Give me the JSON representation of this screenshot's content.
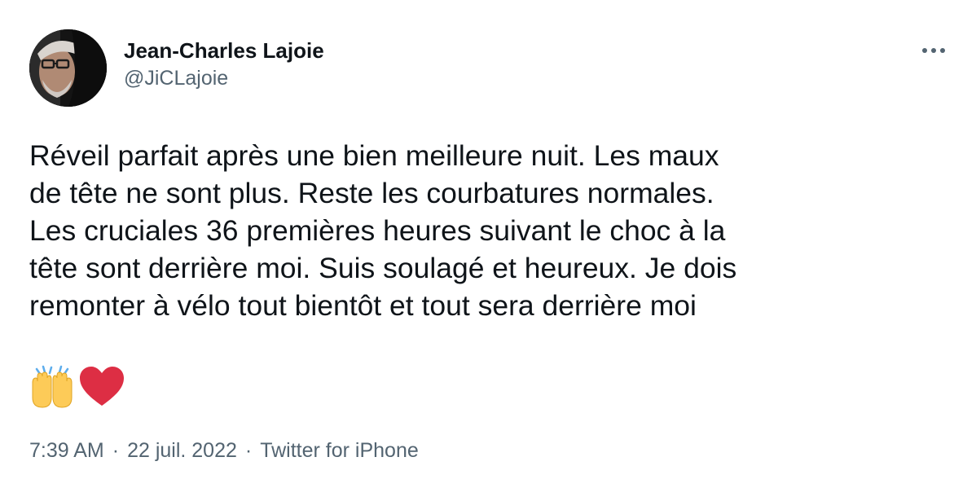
{
  "author": {
    "display_name": "Jean-Charles Lajoie",
    "handle": "@JiCLajoie",
    "avatar_icon": "profile-photo"
  },
  "actions": {
    "more_icon": "more-horizontal-icon"
  },
  "tweet": {
    "text": "Réveil parfait après une bien meilleure nuit. Les maux\nde tête ne sont plus. Reste les courbatures normales.\nLes cruciales 36 premières heures suivant le choc à la\ntête sont derrière moi. Suis soulagé et heureux. Je dois\nremonter à vélo tout bientôt et tout sera derrière moi",
    "emojis": [
      "raising-hands-emoji",
      "red-heart-emoji"
    ]
  },
  "meta": {
    "time": "7:39 AM",
    "separator": "·",
    "date": "22 juil. 2022",
    "source": "Twitter for iPhone"
  },
  "colors": {
    "text_primary": "#0f1419",
    "text_secondary": "#536471",
    "heart": "#dd2e44",
    "hands": "#fdcb58"
  }
}
